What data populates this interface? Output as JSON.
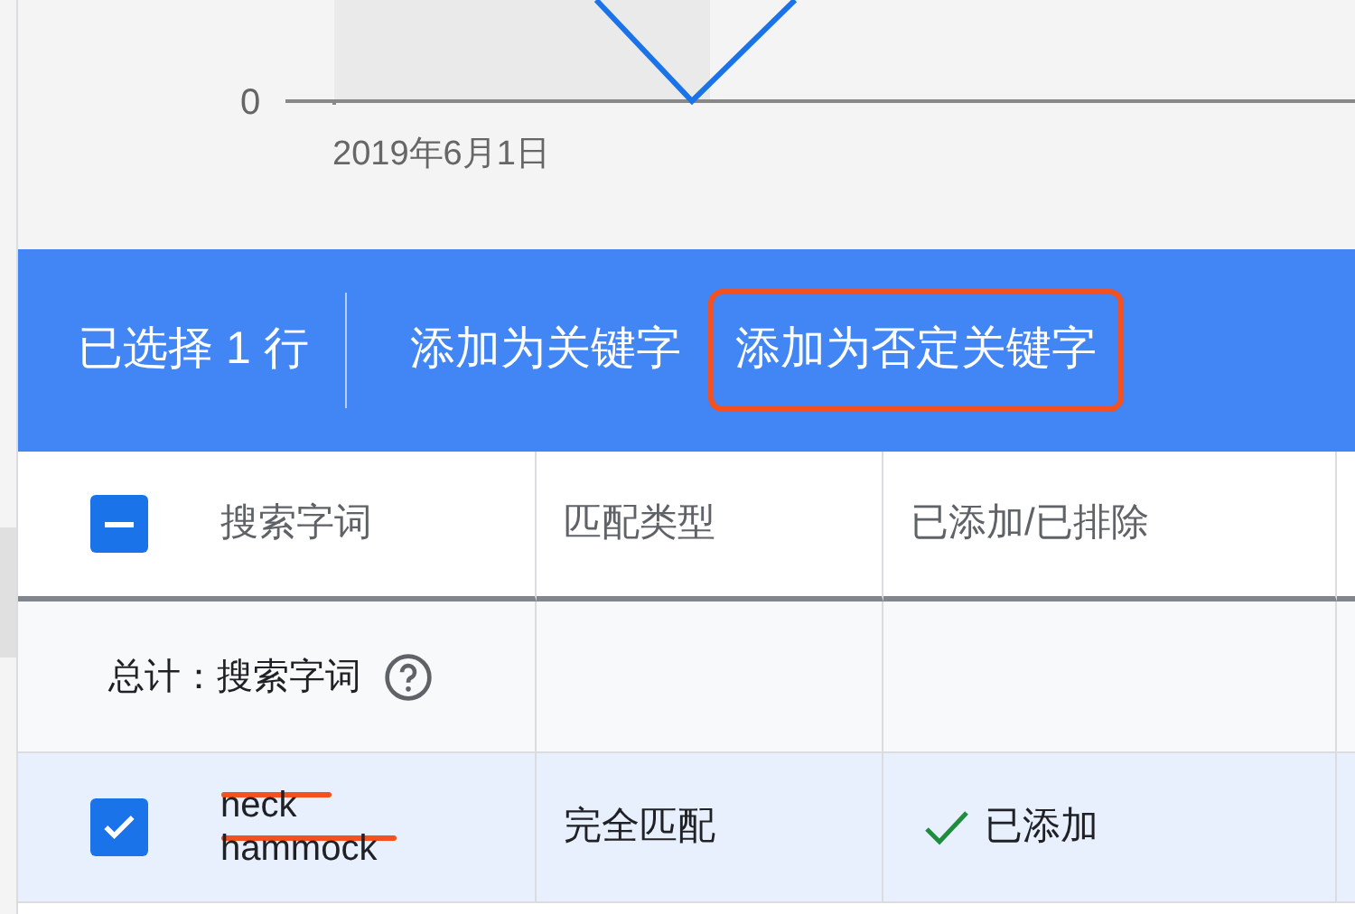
{
  "chart": {
    "y_tick": "0",
    "x_tick": "2019年6月1日"
  },
  "selection_bar": {
    "count_text": "已选择 1 行",
    "actions": [
      {
        "label": "添加为关键字",
        "highlighted": false
      },
      {
        "label": "添加为否定关键字",
        "highlighted": true
      }
    ]
  },
  "table": {
    "header_checkbox_indeterminate": true,
    "columns": [
      "搜索字词",
      "匹配类型",
      "已添加/已排除"
    ],
    "total_row": {
      "label": "总计：搜索字词"
    },
    "rows": [
      {
        "checked": true,
        "search_term": "neck hammock",
        "redacted": true,
        "match_type": "完全匹配",
        "status": "已添加"
      }
    ]
  }
}
